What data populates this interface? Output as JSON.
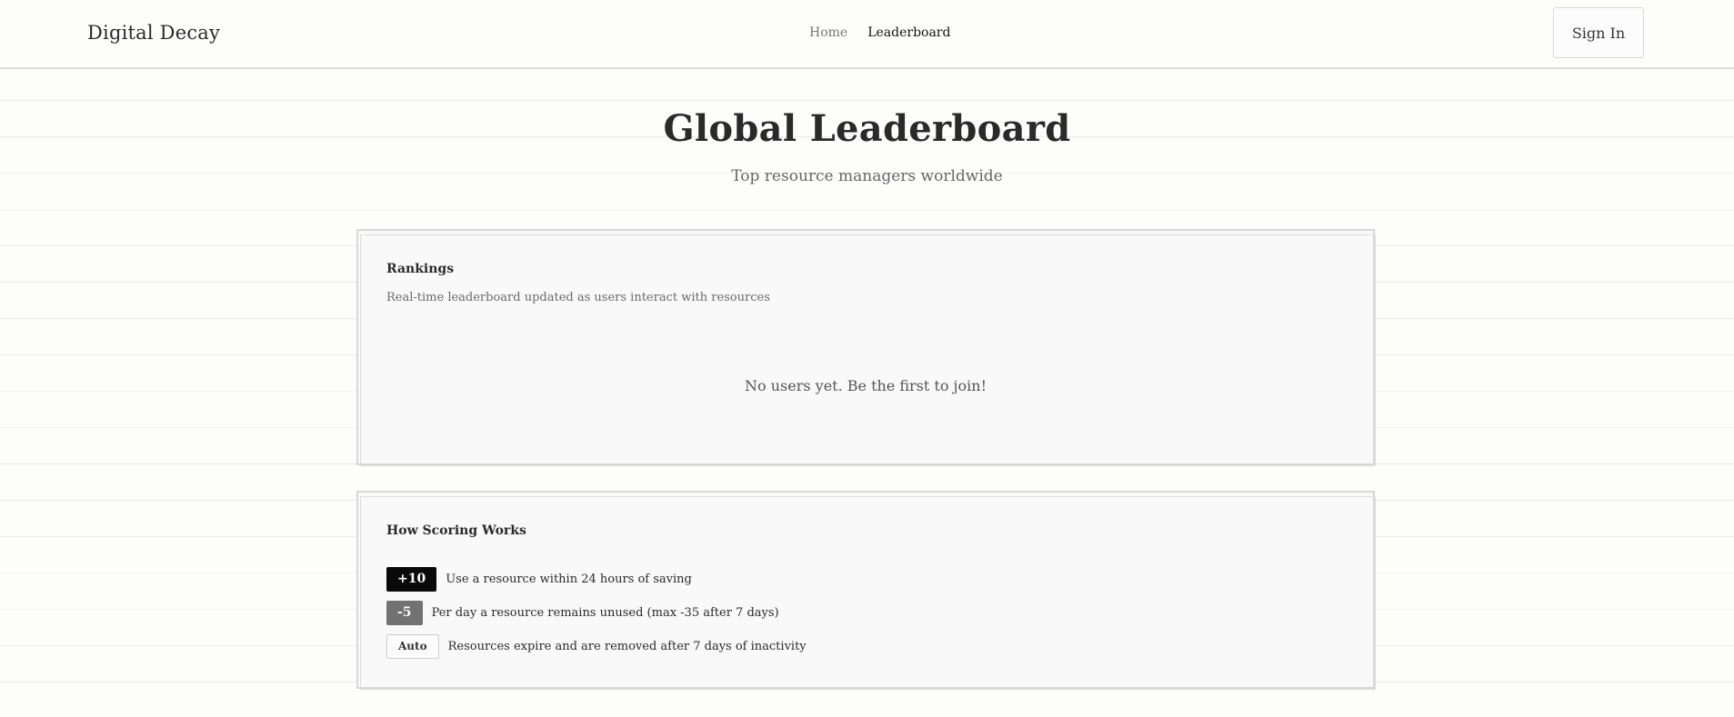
{
  "header": {
    "brand": "Digital Decay",
    "nav": {
      "home": "Home",
      "leaderboard": "Leaderboard"
    },
    "sign_in": "Sign In"
  },
  "hero": {
    "title": "Global Leaderboard",
    "subtitle": "Top resource managers worldwide"
  },
  "rankings": {
    "title": "Rankings",
    "description": "Real-time leaderboard updated as users interact with resources",
    "empty": "No users yet. Be the first to join!"
  },
  "scoring": {
    "title": "How Scoring Works",
    "rules": [
      {
        "badge": "+10",
        "text": "Use a resource within 24 hours of saving"
      },
      {
        "badge": "-5",
        "text": "Per day a resource remains unused (max -35 after 7 days)"
      },
      {
        "badge": "Auto",
        "text": "Resources expire and are removed after 7 days of inactivity"
      }
    ]
  },
  "colors": {
    "background": "#fdfdfc",
    "card": "#f9f9f9",
    "badge_positive": "#0a0a0a",
    "badge_negative": "#727272"
  }
}
